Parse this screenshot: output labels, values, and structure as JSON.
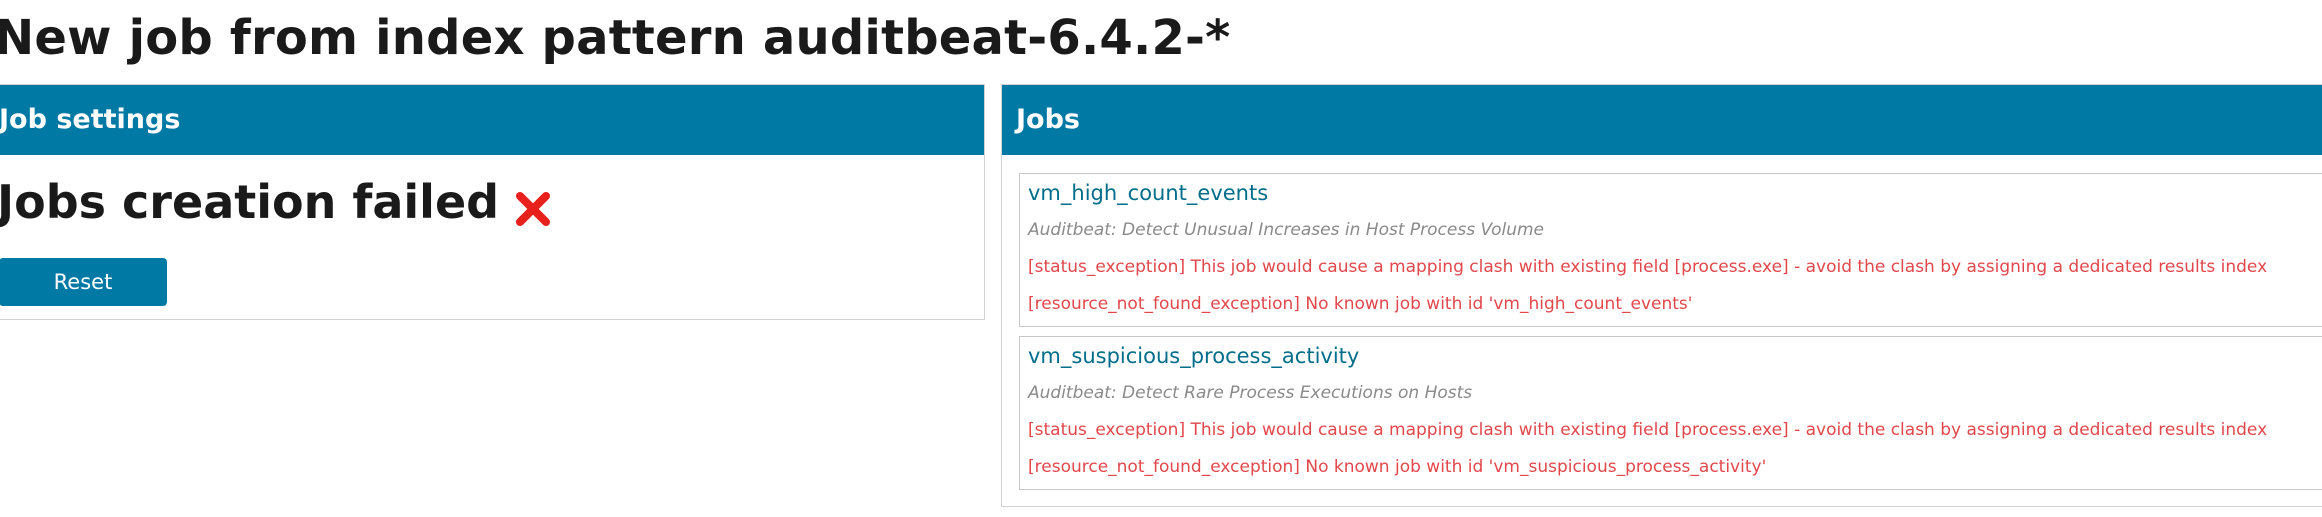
{
  "page": {
    "title": "New job from index pattern auditbeat-6.4.2-*"
  },
  "job_settings": {
    "header": "Job settings",
    "result": "Jobs creation failed",
    "result_icon": "failure-x-icon",
    "reset_label": "Reset"
  },
  "jobs_panel": {
    "header": "Jobs",
    "jobs": [
      {
        "id": "vm_high_count_events",
        "description": "Auditbeat: Detect Unusual Increases in Host Process Volume",
        "errors": [
          "[status_exception] This job would cause a mapping clash with existing field [process.exe] - avoid the clash by assigning a dedicated results index",
          "[resource_not_found_exception] No known job with id 'vm_high_count_events'"
        ]
      },
      {
        "id": "vm_suspicious_process_activity",
        "description": "Auditbeat: Detect Rare Process Executions on Hosts",
        "errors": [
          "[status_exception] This job would cause a mapping clash with existing field [process.exe] - avoid the clash by assigning a dedicated results index",
          "[resource_not_found_exception] No known job with id 'vm_suspicious_process_activity'"
        ]
      }
    ]
  },
  "colors": {
    "header_bg": "#0079a5",
    "link": "#006e8a",
    "error": "#e2474b",
    "fail_icon": "#e8201c"
  }
}
